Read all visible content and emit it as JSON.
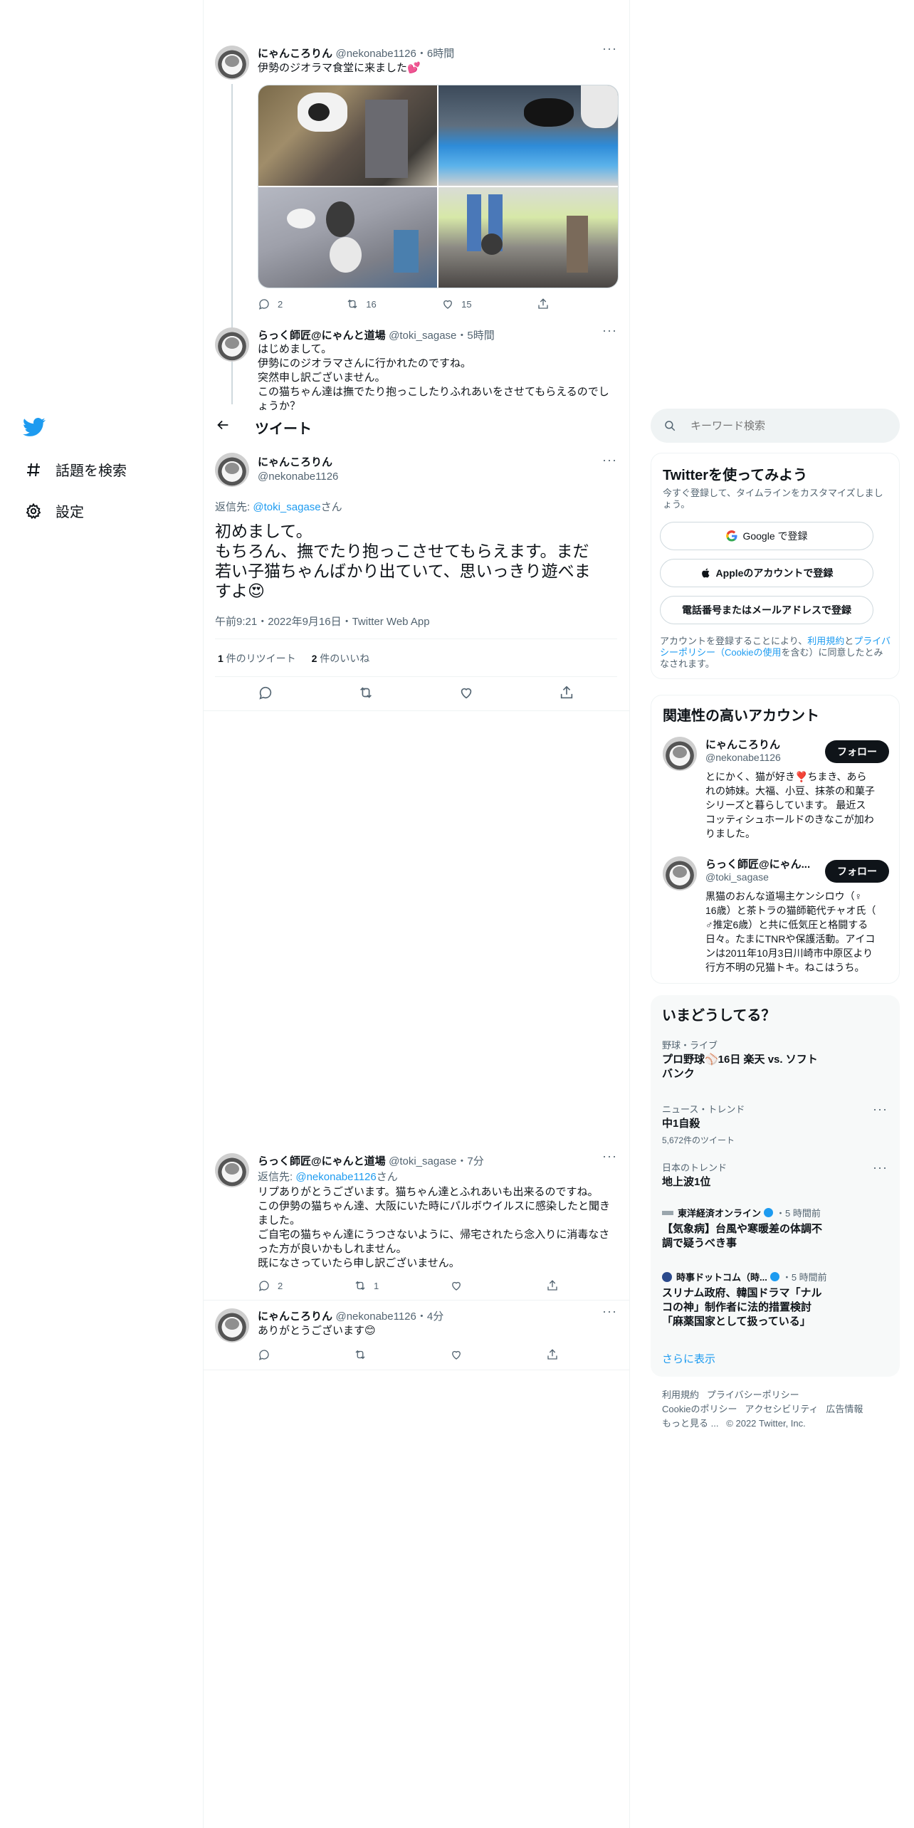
{
  "colors": {
    "accent": "#1d9bf0",
    "text": "#0f1419",
    "muted": "#536471",
    "border": "#eff3f4",
    "heart": "#f91880"
  },
  "nav": {
    "logo": "twitter-bird",
    "explore": "話題を検索",
    "settings": "設定"
  },
  "tweets": [
    {
      "name": "にゃんころりん",
      "handle": "@nekonabe1126",
      "time": "・6時間",
      "text": "伊勢のジオラマ食堂に来ました💕",
      "replies": "2",
      "retweets": "16",
      "likes": "15"
    },
    {
      "name": "らっく師匠@にゃんと道場",
      "handle": "@toki_sagase",
      "time": "・5時間",
      "lines": [
        "はじめまして。",
        "伊勢にのジオラマさんに行かれたのですね。",
        "突然申し訳ございません。",
        "この猫ちゃん達は撫でたり抱っこしたりふれあいをさせてもらえるのでしょうか？"
      ]
    }
  ],
  "header": {
    "title": "ツイート"
  },
  "focus": {
    "name": "にゃんころりん",
    "handle": "@nekonabe1126",
    "reply_prefix": "返信先: ",
    "reply_to": "@toki_sagase",
    "reply_suffix": "さん",
    "lines": [
      "初めまして。",
      "もちろん、撫でたり抱っこさせてもらえます。まだ",
      "若い子猫ちゃんばかり出ていて、思いっきり遊べま",
      "すよ😍"
    ],
    "meta": "午前9:21・2022年9月16日・Twitter Web App",
    "retweet_count": "1",
    "retweet_label": " 件のリツイート",
    "like_count": "2",
    "like_label": " 件のいいね"
  },
  "replies": [
    {
      "name": "らっく師匠@にゃんと道場",
      "handle": "@toki_sagase",
      "time": "・7分",
      "reply_prefix": "返信先: ",
      "reply_to": "@nekonabe1126",
      "reply_suffix": "さん",
      "lines": [
        "リプありがとうございます。猫ちゃん達とふれあいも出来るのですね。",
        "この伊勢の猫ちゃん達、大阪にいた時にパルボウイルスに感染したと聞き",
        "ました。",
        "ご自宅の猫ちゃん達にうつさないように、帰宅されたら念入りに消毒なさ",
        "った方が良いかもしれません。",
        "既になさっていたら申し訳ございません。"
      ],
      "replies": "2",
      "retweets": "1"
    },
    {
      "name": "にゃんころりん",
      "handle": "@nekonabe1126",
      "time": "・4分",
      "text": "ありがとうございます😊"
    }
  ],
  "search": {
    "placeholder": "キーワード検索"
  },
  "signup": {
    "title": "Twitterを使ってみよう",
    "subtitle": "今すぐ登録して、タイムラインをカスタマイズしましょう。",
    "google": "Google で登録",
    "apple": "Appleのアカウントで登録",
    "phone": "電話番号またはメールアドレスで登録",
    "legal_a": "アカウントを登録することにより、",
    "legal_link1": "利用規約",
    "legal_b": "と",
    "legal_link2": "プライバシーポリシー（Cookieの使用",
    "legal_c": "を含む）に同意したとみなされます。"
  },
  "related": {
    "title": "関連性の高いアカウント",
    "follow": "フォロー",
    "accounts": [
      {
        "name": "にゃんころりん",
        "handle": "@nekonabe1126",
        "bio": [
          "とにかく、猫が好き❣️ちまき、あら",
          "れの姉妹。大福、小豆、抹茶の和菓子",
          "シリーズと暮らしています。 最近ス",
          "コッティシュホールドのきなこが加わ",
          "りました。"
        ]
      },
      {
        "name": "らっく師匠@にゃん...",
        "handle": "@toki_sagase",
        "bio": [
          "黒猫のおんな道場主ケンシロウ（♀",
          "16歳）と茶トラの猫師範代チャオ氏（",
          "♂推定6歳）と共に低気圧と格闘する",
          "日々。たまにTNRや保護活動。アイコ",
          "ンは2011年10月3日川崎市中原区より",
          "行方不明の兄猫トキ。ねこはうち。"
        ]
      }
    ]
  },
  "trends": {
    "title": "いまどうしてる？",
    "items": [
      {
        "cat": "野球・ライブ",
        "title": [
          "プロ野球⚾16日 楽天 vs. ソフト",
          "バンク"
        ]
      },
      {
        "cat": "ニュース・トレンド",
        "title": [
          "中1自殺"
        ],
        "count": "5,672件のツイート"
      },
      {
        "cat": "日本のトレンド",
        "title": [
          "地上波1位"
        ]
      },
      {
        "source": "東洋経済オンライン",
        "time": "・5 時間前",
        "title": [
          "【気象病】台風や寒暖差の体調不",
          "調で疑うべき事"
        ]
      },
      {
        "source": "時事ドットコム（時...",
        "time": "・5 時間前",
        "title": [
          "スリナム政府、韓国ドラマ「ナル",
          "コの神」制作者に法的措置検討",
          "「麻薬国家として扱っている」"
        ]
      }
    ],
    "more": "さらに表示"
  },
  "footer": {
    "row1": [
      "利用規約",
      "プライバシーポリシー"
    ],
    "row2": [
      "Cookieのポリシー",
      "アクセシビリティ",
      "広告情報"
    ],
    "more": "もっと見る ...",
    "copyright": "© 2022 Twitter, Inc."
  }
}
